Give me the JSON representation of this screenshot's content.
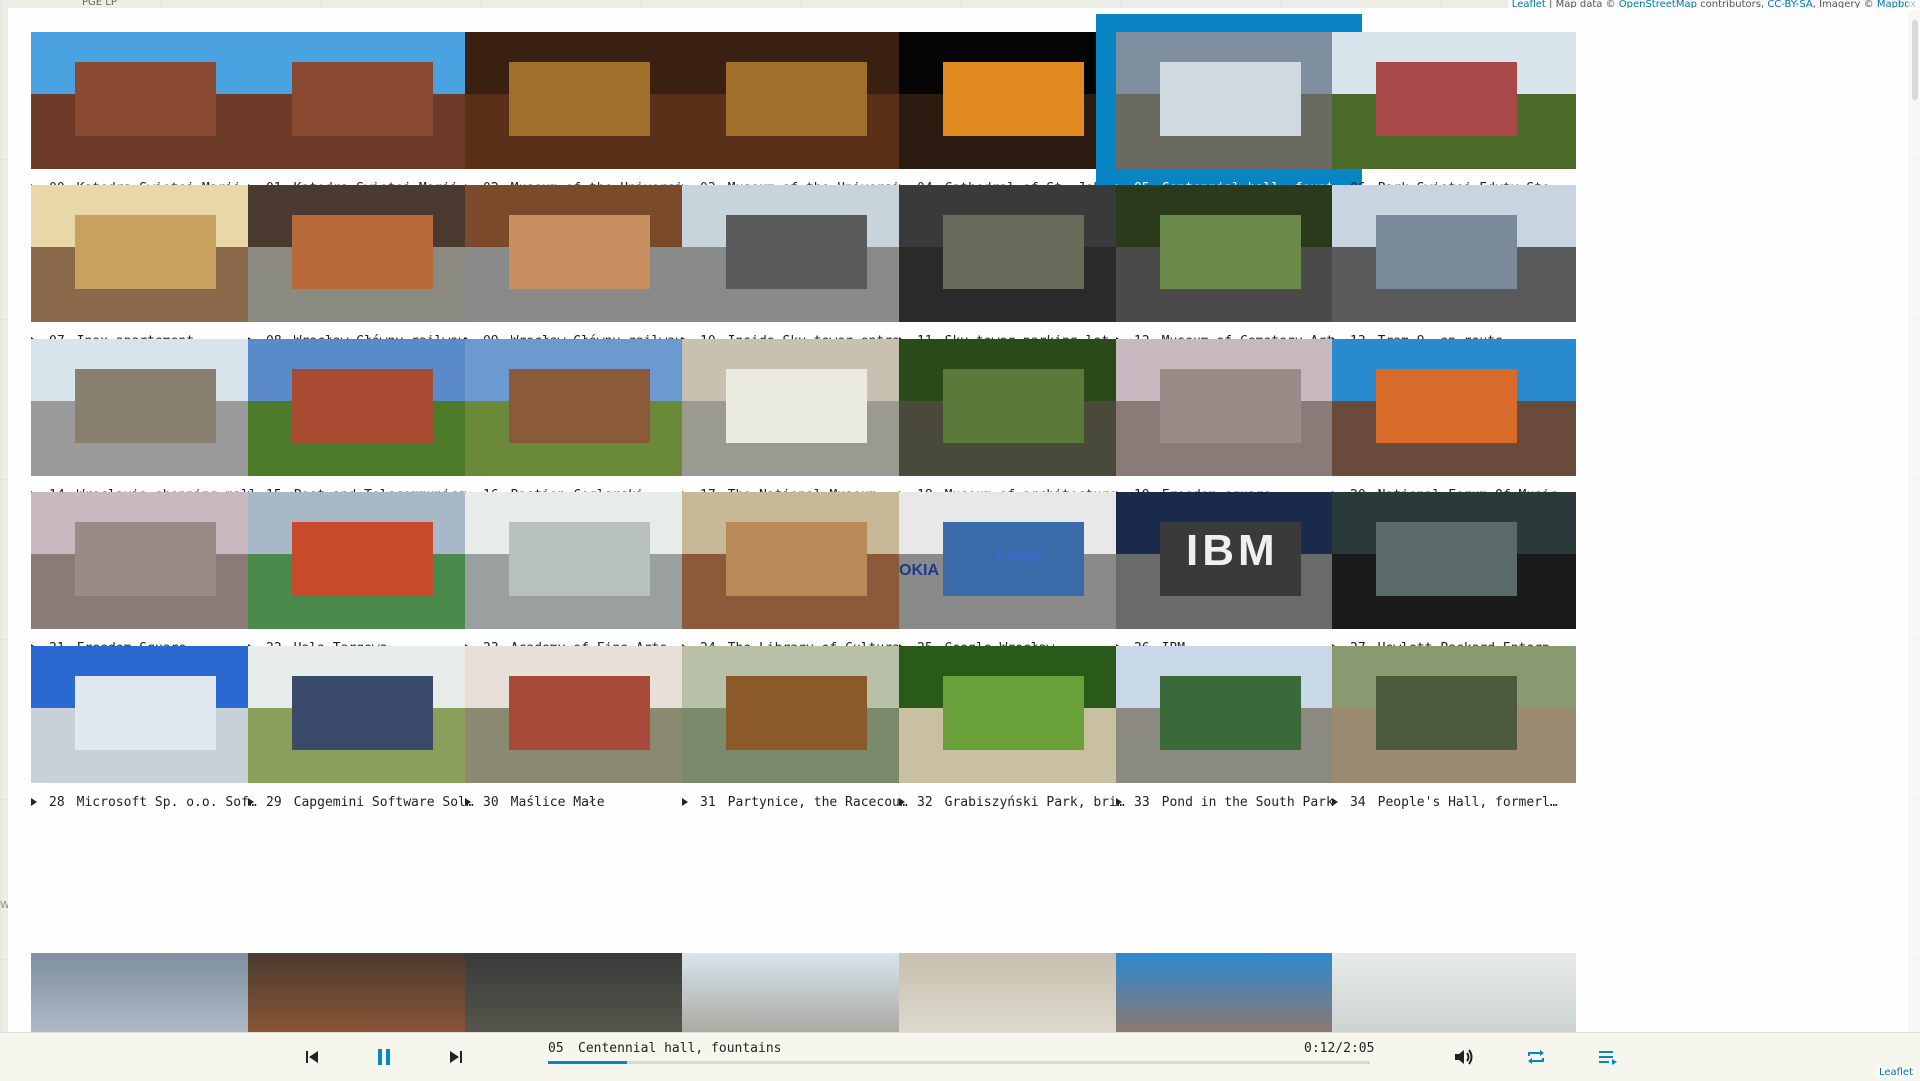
{
  "map": {
    "top_label": "PGE LP",
    "attribution_prefix": "Leaflet",
    "attribution_mid": " | Map data © ",
    "attribution_osm": "OpenStreetMap",
    "attribution_contrib": " contributors, ",
    "attribution_license": "CC-BY-SA",
    "attribution_imagery": ", Imagery © ",
    "attribution_mapbox": "Mapbox",
    "bottom_label": "Leaflet",
    "left_label": "W",
    "zoom_in": "+"
  },
  "playlist": {
    "active_index": 5,
    "items": [
      {
        "num": "00",
        "title": "Katedra Świętej Marii Ma…"
      },
      {
        "num": "01",
        "title": "Katedra Świętej Marii Ma…"
      },
      {
        "num": "02",
        "title": "Museum of the University…"
      },
      {
        "num": "03",
        "title": "Museum of the University…"
      },
      {
        "num": "04",
        "title": "Cathedral of St. John th…"
      },
      {
        "num": "05",
        "title": "Centennial hall, fountai…"
      },
      {
        "num": "06",
        "title": "Park Świętej Edyty Stein"
      },
      {
        "num": "07",
        "title": "Inox apartement"
      },
      {
        "num": "08",
        "title": "Wrocław Główny railway s…"
      },
      {
        "num": "09",
        "title": "Wrocław Główny railway s…"
      },
      {
        "num": "10",
        "title": "Inside Sky tower entranc…"
      },
      {
        "num": "11",
        "title": "Sky tower parking lot"
      },
      {
        "num": "12",
        "title": "Museum of Cemetery Art"
      },
      {
        "num": "13",
        "title": "Tram 9, en route"
      },
      {
        "num": "14",
        "title": "Wroclavia shopping mall"
      },
      {
        "num": "15",
        "title": "Post and Telecommunicati…"
      },
      {
        "num": "16",
        "title": "Bastion Ceglarski"
      },
      {
        "num": "17",
        "title": "The National Museum"
      },
      {
        "num": "18",
        "title": "Museum of architecture"
      },
      {
        "num": "19",
        "title": "Freedom square"
      },
      {
        "num": "20",
        "title": "National Forum Of Music"
      },
      {
        "num": "21",
        "title": "Freedom Square"
      },
      {
        "num": "22",
        "title": "Hala Targowa"
      },
      {
        "num": "23",
        "title": "Academy of Fine Arts"
      },
      {
        "num": "24",
        "title": "The Library of Cultural …"
      },
      {
        "num": "25",
        "title": "Google Wrocław"
      },
      {
        "num": "26",
        "title": "IBM"
      },
      {
        "num": "27",
        "title": "Hewlett Packard Enterpri…"
      },
      {
        "num": "28",
        "title": "Microsoft Sp. o.o. Softw…"
      },
      {
        "num": "29",
        "title": "Capgemini Software Solut…"
      },
      {
        "num": "30",
        "title": "Maślice Małe"
      },
      {
        "num": "31",
        "title": "Partynice, the Racecourse"
      },
      {
        "num": "32",
        "title": "Grabiszyński Park, bridg…"
      },
      {
        "num": "33",
        "title": "Pond in the South Park"
      },
      {
        "num": "34",
        "title": "People's Hall, formerly …"
      }
    ],
    "thumb_text": {
      "nokia": "OKIA",
      "google": "Google",
      "ibm": "IBM"
    }
  },
  "player": {
    "track_num": "05",
    "track_title": "Centennial hall, fountains",
    "time": "0:12/2:05",
    "progress": 0.096,
    "icons": {
      "prev": "skip-previous-icon",
      "pause": "pause-icon",
      "next": "skip-next-icon",
      "volume": "volume-icon",
      "repeat": "repeat-icon",
      "playlist": "playlist-icon"
    },
    "accent": "#0a85c4"
  }
}
